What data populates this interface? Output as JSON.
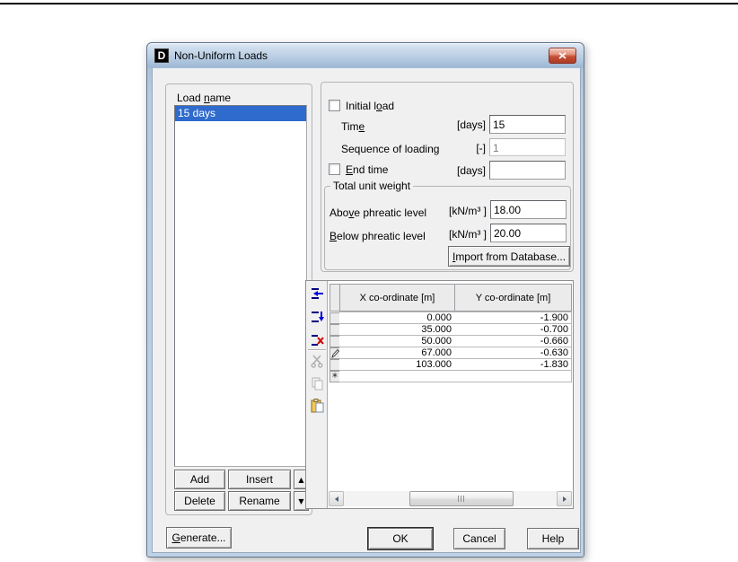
{
  "window": {
    "title": "Non-Uniform Loads",
    "icon_text": "D"
  },
  "left_panel": {
    "load_name_label": {
      "text": "Load name",
      "accel_index": 5
    },
    "list_items": [
      "15 days"
    ],
    "selected_item": "15 days",
    "add": "Add",
    "insert": "Insert",
    "delete": "Delete",
    "rename": "Rename",
    "move_up_glyph": "▲",
    "move_down_glyph": "▼"
  },
  "load_section": {
    "initial_load": {
      "text": "Initial load",
      "accel_index": 9,
      "checked": false
    },
    "time_label": {
      "text": "Time",
      "accel_index": 3
    },
    "time_unit": "[days]",
    "time_value": "15",
    "sequence_label": "Sequence of loading",
    "sequence_unit": "[-]",
    "sequence_value": "1",
    "end_time": {
      "text": "End time",
      "accel_index": 0,
      "checked": false
    },
    "end_time_unit": "[days]",
    "end_time_value": ""
  },
  "unit_weight": {
    "group_title": "Total unit weight",
    "above_label": {
      "text": "Above phreatic level",
      "accel_index": 3
    },
    "above_unit": "[kN/m³ ]",
    "above_value": "18.00",
    "below_label": {
      "text": "Below phreatic level",
      "accel_index": 0
    },
    "below_unit": "[kN/m³ ]",
    "below_value": "20.00",
    "import_button": {
      "text": "Import from Database...",
      "accel_index": 0
    }
  },
  "coordinates_table": {
    "columns": [
      "X co-ordinate [m]",
      "Y co-ordinate [m]"
    ],
    "rows": [
      {
        "x": "0.000",
        "y": "-1.900",
        "marker": ""
      },
      {
        "x": "35.000",
        "y": "-0.700",
        "marker": ""
      },
      {
        "x": "50.000",
        "y": "-0.660",
        "marker": ""
      },
      {
        "x": "67.000",
        "y": "-0.630",
        "marker": "pencil"
      },
      {
        "x": "103.000",
        "y": "-1.830",
        "marker": ""
      },
      {
        "x": "",
        "y": "",
        "marker": "asterisk"
      }
    ],
    "new_row_glyph": "*",
    "toolbar_icons": [
      "add-row",
      "insert-row",
      "delete-row",
      "cut",
      "copy",
      "paste"
    ]
  },
  "footer": {
    "generate": {
      "text": "Generate...",
      "accel_index": 0
    },
    "ok": "OK",
    "cancel": "Cancel",
    "help": "Help"
  },
  "colors": {
    "selection_blue": "#2e6bcd",
    "titlebar_top": "#e3ecf6",
    "titlebar_bottom": "#9db7d3",
    "close_red": "#c04c33",
    "client_bg": "#f0f0f0"
  }
}
